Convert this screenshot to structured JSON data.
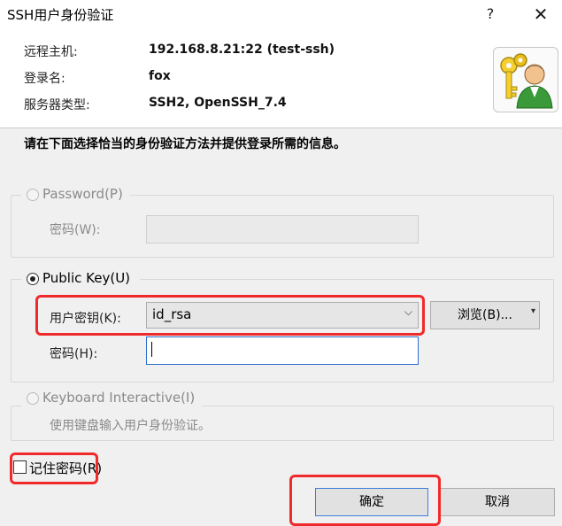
{
  "window": {
    "title": "SSH用户身份验证",
    "help": "?",
    "close": "✕"
  },
  "info": {
    "remote_host_label": "远程主机:",
    "remote_host_value": "192.168.8.21:22 (test-ssh)",
    "login_label": "登录名:",
    "login_value": "fox",
    "server_type_label": "服务器类型:",
    "server_type_value": "SSH2, OpenSSH_7.4",
    "icon": "keys-user-icon"
  },
  "instruction": "请在下面选择恰当的身份验证方法并提供登录所需的信息。",
  "password_group": {
    "radio_label": "Password(P)",
    "password_label": "密码(W):",
    "password_value": "",
    "enabled": false
  },
  "publickey_group": {
    "radio_label": "Public Key(U)",
    "selected": true,
    "user_key_label": "用户密钥(K):",
    "user_key_value": "id_rsa",
    "browse_label": "浏览(B)...",
    "password_label": "密码(H):",
    "password_value": ""
  },
  "keyboard_group": {
    "radio_label": "Keyboard Interactive(I)",
    "description": "使用键盘输入用户身份验证。",
    "enabled": false
  },
  "remember_password": {
    "label": "记住密码(R)",
    "checked": false
  },
  "buttons": {
    "ok": "确定",
    "cancel": "取消"
  },
  "colors": {
    "highlight": "#f02a2a",
    "focus": "#2b6fce"
  }
}
